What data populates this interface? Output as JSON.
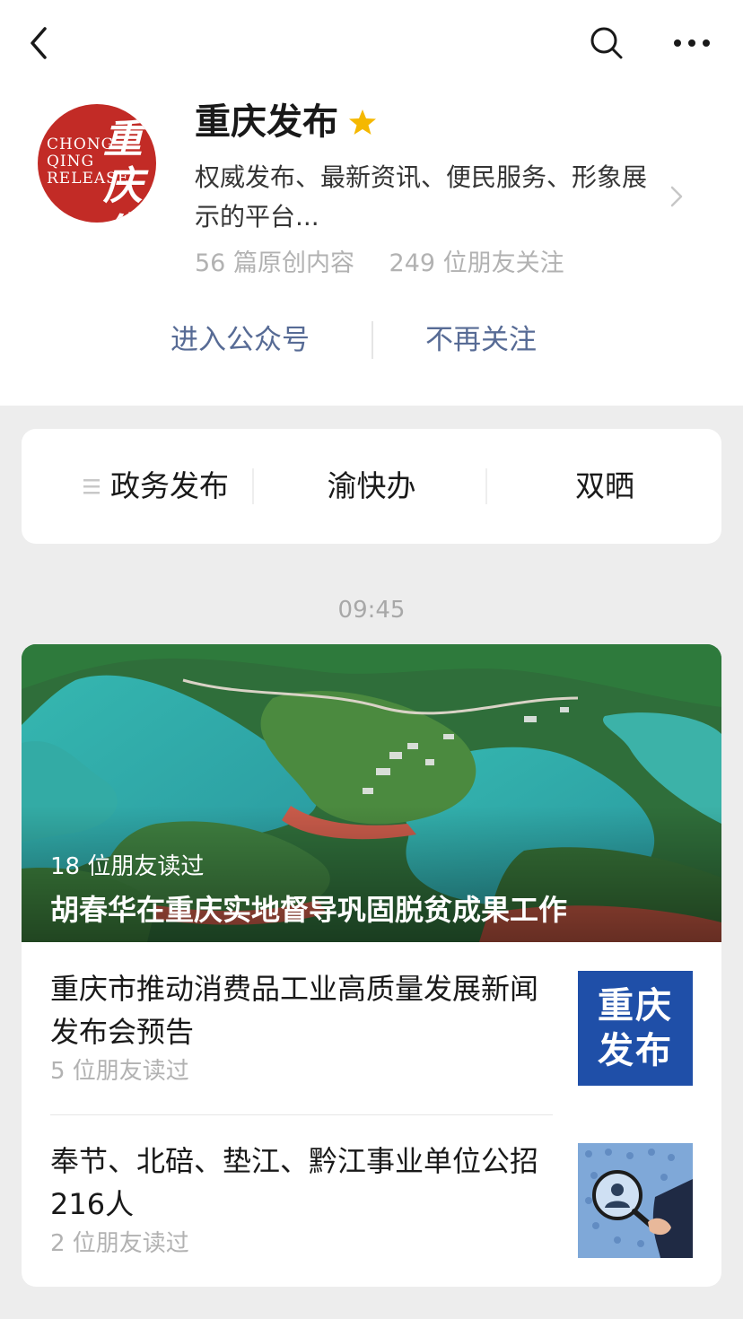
{
  "nav": {
    "back_icon": "chevron-left-icon",
    "search_icon": "search-icon",
    "more_icon": "more-dots-icon"
  },
  "profile": {
    "avatar_latin": [
      "CHONG",
      "QING",
      "RELEASE"
    ],
    "avatar_han": "重庆发布",
    "name": "重庆发布",
    "star_icon": "star-icon",
    "star_color": "#f5b800",
    "description": "权威发布、最新资讯、便民服务、形象展示的平台...",
    "original_count": "56 篇原创内容",
    "friends_following": "249 位朋友关注",
    "enter_label": "进入公众号",
    "unfollow_label": "不再关注",
    "accent_color": "#576b95",
    "avatar_color": "#c22b26"
  },
  "menu": {
    "items": [
      {
        "label": "政务发布",
        "icon": "hamburger-icon"
      },
      {
        "label": "渝快办"
      },
      {
        "label": "双晒"
      }
    ]
  },
  "feed": {
    "time": "09:45",
    "hero": {
      "reads": "18 位朋友读过",
      "title": "胡春华在重庆实地督导巩固脱贫成果工作"
    },
    "articles": [
      {
        "title": "重庆市推动消费品工业高质量发展新闻发布会预告",
        "reads": "5 位朋友读过",
        "thumb_text": [
          "重庆",
          "发布"
        ],
        "thumb_color": "#1f4fa8"
      },
      {
        "title": "奉节、北碚、垫江、黔江事业单位公招216人",
        "reads": "2 位朋友读过",
        "thumb_icon": "magnifier-person-icon"
      }
    ]
  }
}
